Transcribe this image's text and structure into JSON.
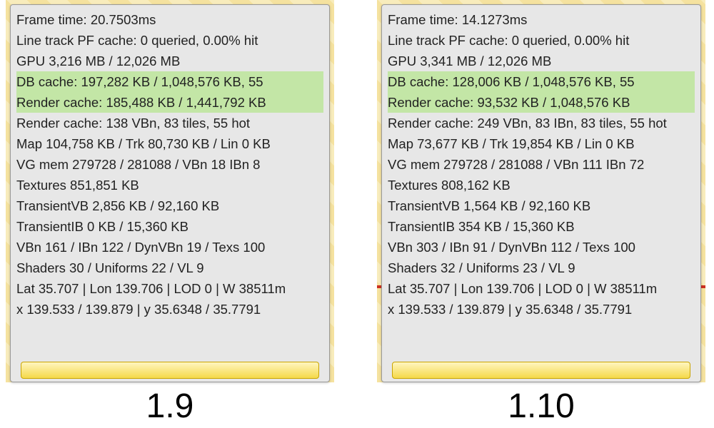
{
  "left": {
    "frame_time": "Frame time: 20.7503ms",
    "line_track": "Line track PF cache: 0 queried, 0.00% hit",
    "gpu": "GPU 3,216 MB / 12,026 MB",
    "db_cache": "DB cache: 197,282 KB / 1,048,576 KB, 55",
    "render_cache": "Render cache: 185,488 KB / 1,441,792 KB",
    "render_cache2": "Render cache: 138 VBn, 83 tiles, 55 hot",
    "map": "Map 104,758 KB / Trk 80,730 KB / Lin 0 KB",
    "vg_mem": "VG mem 279728 / 281088 / VBn 18 IBn 8",
    "textures": "Textures 851,851 KB",
    "transient_vb": "TransientVB 2,856 KB / 92,160 KB",
    "transient_ib": "TransientIB 0 KB / 15,360 KB",
    "vbn": "VBn 161 / IBn 122 / DynVBn 19 / Texs 100",
    "shaders": "Shaders 30 / Uniforms 22 / VL 9",
    "lat": "Lat 35.707 | Lon 139.706 | LOD 0 | W 38511m",
    "xy": "x 139.533 / 139.879 | y 35.6348 / 35.7791",
    "version": "1.9"
  },
  "right": {
    "frame_time": "Frame time: 14.1273ms",
    "line_track": "Line track PF cache: 0 queried, 0.00% hit",
    "gpu": "GPU 3,341 MB / 12,026 MB",
    "db_cache": "DB cache: 128,006 KB / 1,048,576 KB, 55",
    "render_cache": "Render cache: 93,532 KB / 1,048,576 KB",
    "render_cache2": "Render cache: 249 VBn, 83 IBn, 83 tiles, 55 hot",
    "map": "Map 73,677 KB / Trk 19,854 KB / Lin 0 KB",
    "vg_mem": "VG mem 279728 / 281088 / VBn 111 IBn 72",
    "textures": "Textures 808,162 KB",
    "transient_vb": "TransientVB 1,564 KB / 92,160 KB",
    "transient_ib": "TransientIB 354 KB / 15,360 KB",
    "vbn": "VBn 303 / IBn 91 / DynVBn 112 / Texs 100",
    "shaders": "Shaders 32 / Uniforms 23 / VL 9",
    "lat": "Lat 35.707 | Lon 139.706 | LOD 0 | W 38511m",
    "xy": "x 139.533 / 139.879 | y 35.6348 / 35.7791",
    "version": "1.10"
  }
}
